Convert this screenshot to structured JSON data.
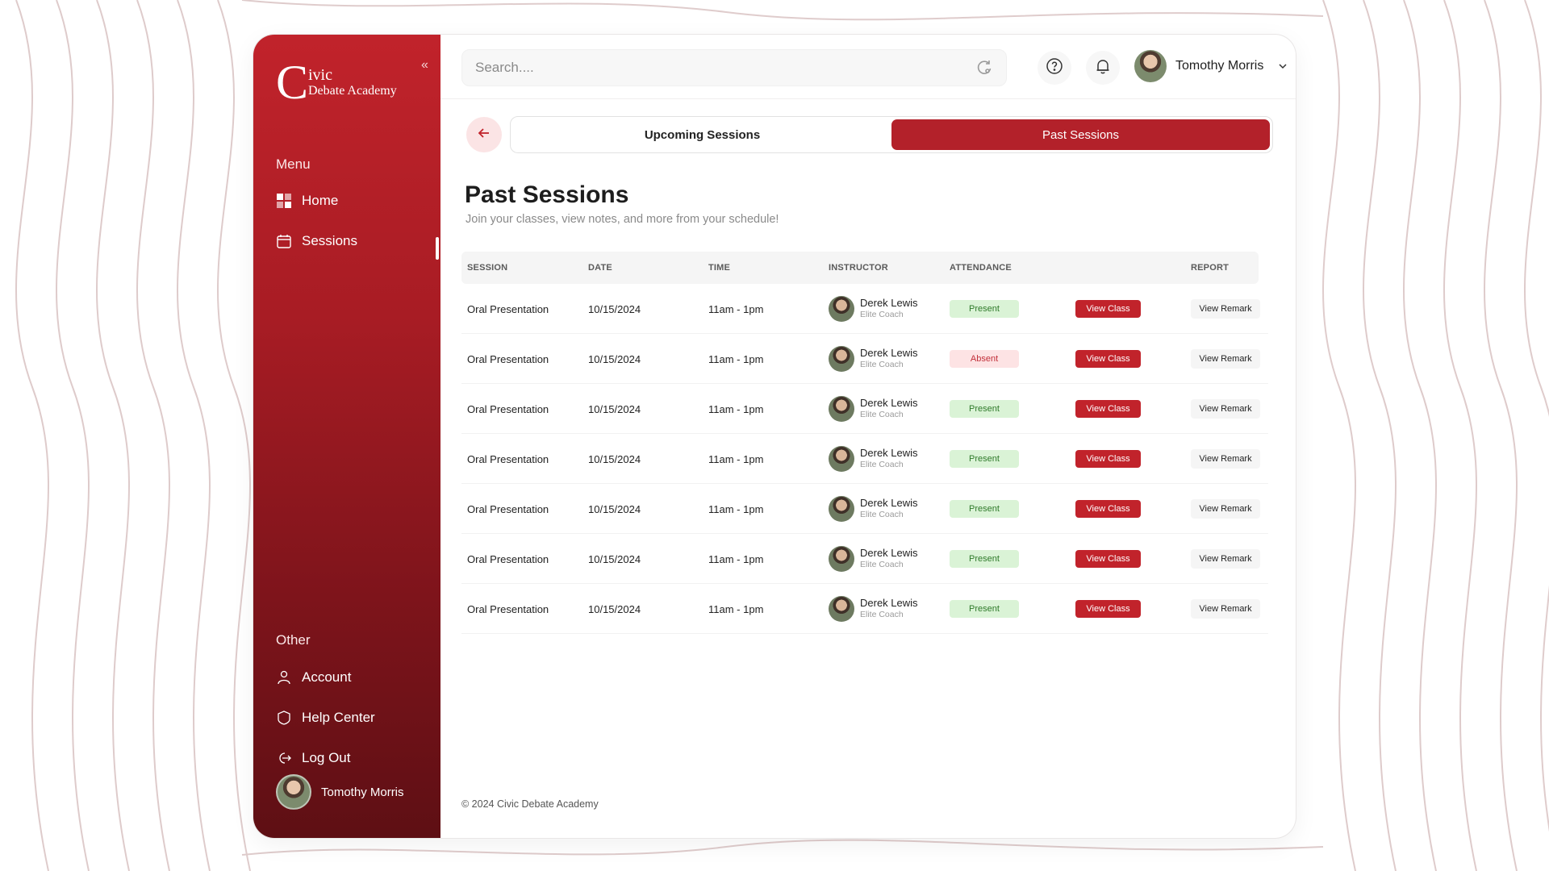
{
  "sidebar": {
    "logo_initial": "C",
    "logo_name": "ivic",
    "logo_sub": "Debate Academy",
    "menu_label": "Menu",
    "menu_items": [
      {
        "label": "Home",
        "icon": "grid-icon"
      },
      {
        "label": "Sessions",
        "icon": "calendar-icon"
      }
    ],
    "other_label": "Other",
    "other_items": [
      {
        "label": "Account",
        "icon": "user-icon"
      },
      {
        "label": "Help Center",
        "icon": "shield-icon"
      },
      {
        "label": "Log Out",
        "icon": "logout-icon"
      }
    ],
    "user_name": "Tomothy Morris"
  },
  "topbar": {
    "search_placeholder": "Search....",
    "user_name": "Tomothy Morris"
  },
  "tabs": {
    "upcoming": "Upcoming Sessions",
    "past": "Past Sessions",
    "active": "past"
  },
  "page": {
    "title": "Past Sessions",
    "subtitle": "Join your classes, view notes, and more from your schedule!"
  },
  "table": {
    "headers": {
      "session": "SESSION",
      "date": "DATE",
      "time": "TIME",
      "instructor": "INSTRUCTOR",
      "attendance": "ATTENDANCE",
      "report": "REPORT"
    },
    "view_class_label": "View Class",
    "view_remark_label": "View Remark",
    "rows": [
      {
        "session": "Oral Presentation",
        "date": "10/15/2024",
        "time": "11am - 1pm",
        "instructor": "Derek Lewis",
        "role": "Elite Coach",
        "attendance": "Present"
      },
      {
        "session": "Oral Presentation",
        "date": "10/15/2024",
        "time": "11am - 1pm",
        "instructor": "Derek Lewis",
        "role": "Elite Coach",
        "attendance": "Absent"
      },
      {
        "session": "Oral Presentation",
        "date": "10/15/2024",
        "time": "11am - 1pm",
        "instructor": "Derek Lewis",
        "role": "Elite Coach",
        "attendance": "Present"
      },
      {
        "session": "Oral Presentation",
        "date": "10/15/2024",
        "time": "11am - 1pm",
        "instructor": "Derek Lewis",
        "role": "Elite Coach",
        "attendance": "Present"
      },
      {
        "session": "Oral Presentation",
        "date": "10/15/2024",
        "time": "11am - 1pm",
        "instructor": "Derek Lewis",
        "role": "Elite Coach",
        "attendance": "Present"
      },
      {
        "session": "Oral Presentation",
        "date": "10/15/2024",
        "time": "11am - 1pm",
        "instructor": "Derek Lewis",
        "role": "Elite Coach",
        "attendance": "Present"
      },
      {
        "session": "Oral Presentation",
        "date": "10/15/2024",
        "time": "11am - 1pm",
        "instructor": "Derek Lewis",
        "role": "Elite Coach",
        "attendance": "Present"
      }
    ]
  },
  "footer": {
    "text": "© 2024 Civic Debate Academy"
  },
  "colors": {
    "brand": "#b3212a",
    "present_bg": "#daf3d6",
    "absent_bg": "#fde3e4"
  }
}
